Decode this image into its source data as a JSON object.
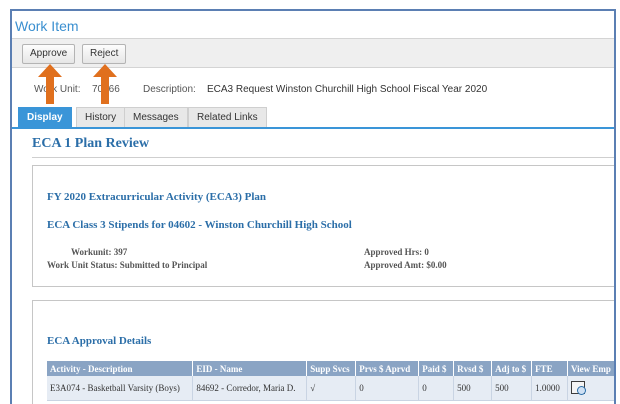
{
  "window": {
    "title": "Work Item"
  },
  "toolbar": {
    "approve_label": "Approve",
    "reject_label": "Reject"
  },
  "workunit_bar": {
    "unit_label": "Work Unit:",
    "unit_value": "70466",
    "desc_label": "Description:",
    "desc_value": "ECA3 Request Winston Churchill High School Fiscal Year 2020"
  },
  "tabs": [
    {
      "label": "Display",
      "active": true
    },
    {
      "label": "History",
      "active": false
    },
    {
      "label": "Messages",
      "active": false
    },
    {
      "label": "Related Links",
      "active": false
    }
  ],
  "main": {
    "title": "ECA 1 Plan Review",
    "plan": {
      "title": "FY 2020 Extracurricular Activity (ECA3) Plan",
      "class_title": "ECA Class 3 Stipends for 04602 - Winston Churchill High School",
      "workunit_label": "Workunit:",
      "workunit_value": "397",
      "status_label": "Work Unit Status:",
      "status_value": "Submitted to Principal",
      "approved_hrs_label": "Approved Hrs:",
      "approved_hrs_value": "0",
      "approved_amt_label": "Approved Amt:",
      "approved_amt_value": "$0.00"
    },
    "approval": {
      "title": "ECA Approval Details",
      "columns": [
        "Activity - Description",
        "EID - Name",
        "Supp Svcs",
        "Prvs $ Aprvd",
        "Paid $",
        "Rvsd $",
        "Adj to $",
        "FTE",
        "View Emp"
      ],
      "rows": [
        [
          "E3A074 - Basketball Varsity (Boys)",
          "84692 - Corredor, Maria D.",
          "√",
          "0",
          "0",
          "500",
          "500",
          "1.0000"
        ]
      ]
    }
  },
  "colors": {
    "accent": "#3a95d8",
    "heading": "#2b6ea8",
    "table_header": "#8aa4c4",
    "annotation_arrow": "#e0701e"
  }
}
